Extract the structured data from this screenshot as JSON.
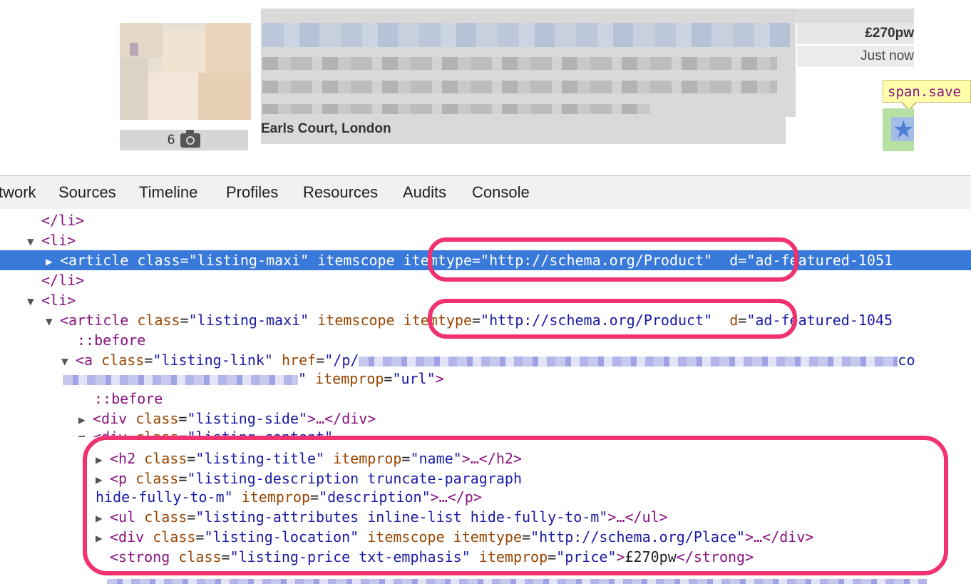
{
  "listing": {
    "photo_count": "6",
    "location": "Earls Court, London",
    "price": "£270pw",
    "posted": "Just now",
    "tooltip": "span.save"
  },
  "devtools": {
    "tabs": [
      "twork",
      "Sources",
      "Timeline",
      "Profiles",
      "Resources",
      "Audits",
      "Console"
    ],
    "rows": [
      {
        "close_li": "</li>"
      },
      {
        "open_li": "<li>"
      },
      {
        "t_open": "<article",
        "a1": " class",
        "eq1": "=",
        "v1": "\"listing-maxi\"",
        "a2": " itemscope",
        "a3": " itemtype",
        "eq3": "=",
        "v3": "\"http://schema.org/Product\"",
        "tail_a": "d",
        "eq4": "=",
        "tail_v": "\"ad-featured-1051"
      },
      {
        "close_li": "</li>"
      },
      {
        "open_li": "<li>"
      },
      {
        "t_open": "<article",
        "a1": " class",
        "eq1": "=",
        "v1": "\"listing-maxi\"",
        "a2": " itemscope",
        "a3": " itemtype",
        "eq3": "=",
        "v3": "\"http://schema.org/Product\"",
        "tail_a": "d",
        "eq4": "=",
        "tail_v": "\"ad-featured-1045"
      },
      {
        "pseudo": "::before"
      },
      {
        "t_open": "<a",
        "a1": " class",
        "eq1": "=",
        "v1": "\"listing-link\"",
        "a2": " href",
        "eq2": "=",
        "v2": "\"/p/",
        "v2_end": "co"
      },
      {
        "v_end": "\"",
        "a1": " itemprop",
        "eq1": "=",
        "v1": "\"url\"",
        "t_close": ">"
      },
      {
        "pseudo": "::before"
      },
      {
        "t_open": "<div",
        "a1": " class",
        "eq1": "=",
        "v1": "\"listing-side\"",
        "t_mid": ">…</div>"
      },
      {
        "t_open": "<div",
        "a1": " class",
        "eq1": "=",
        "v1": "\"listing-content\""
      },
      {
        "t_open": "<h2",
        "a1": " class",
        "eq1": "=",
        "v1": "\"listing-title\"",
        "a2": " itemprop",
        "eq2": "=",
        "v2": "\"name\"",
        "t_mid": ">…</h2>"
      },
      {
        "t_open": "<p",
        "a1": " class",
        "eq1": "=",
        "v1": "\"listing-description truncate-paragraph"
      },
      {
        "v1": "hide-fully-to-m\"",
        "a2": " itemprop",
        "eq2": "=",
        "v2": "\"description\"",
        "t_mid": ">…</p>"
      },
      {
        "t_open": "<ul",
        "a1": " class",
        "eq1": "=",
        "v1": "\"listing-attributes inline-list hide-fully-to-m\"",
        "t_mid": ">…</ul>"
      },
      {
        "t_open": "<div",
        "a1": " class",
        "eq1": "=",
        "v1": "\"listing-location\"",
        "a2": " itemscope",
        "a3": " itemtype",
        "eq3": "=",
        "v3": "\"http://schema.org/Place\"",
        "t_mid": ">…</div>"
      },
      {
        "t_open": "<strong",
        "a1": " class",
        "eq1": "=",
        "v1": "\"listing-price txt-emphasis\"",
        "a2": " itemprop",
        "eq2": "=",
        "v2": "\"price\"",
        "t_gt": ">",
        "text": "£270pw",
        "t_close": "</strong>"
      }
    ]
  },
  "colors": {
    "selection": "#3879d9",
    "tag": "#881280",
    "attr_name": "#994500",
    "attr_value": "#1a1aa6",
    "annotation_ring": "#f0326e",
    "tooltip_bg": "#ffffaa",
    "save_highlight": "#b7e0a4"
  },
  "icons": [
    "camera-icon",
    "star-icon",
    "expand-triangle-icon",
    "collapse-triangle-icon"
  ]
}
